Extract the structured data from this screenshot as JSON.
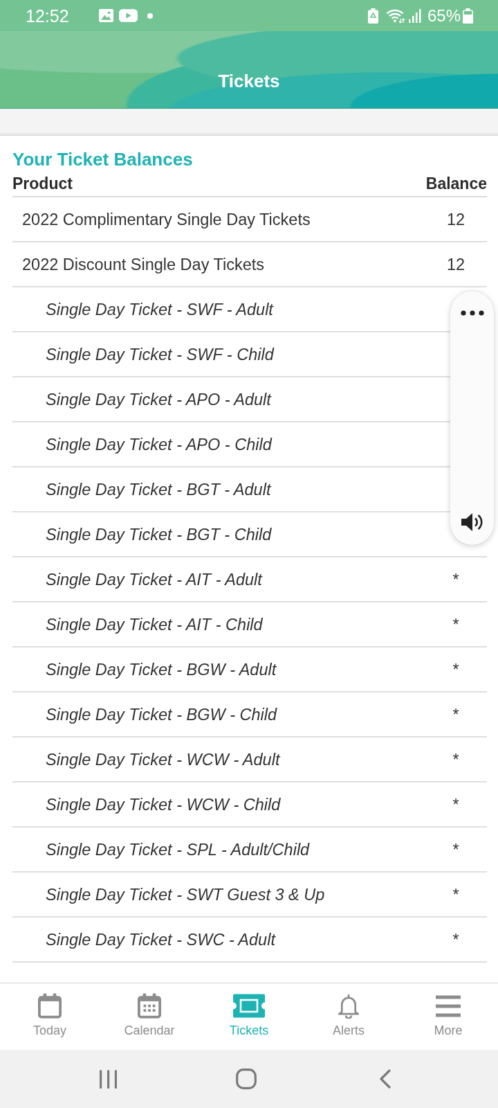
{
  "status_bar": {
    "time": "12:52",
    "battery": "65%"
  },
  "header": {
    "title": "Tickets"
  },
  "balances": {
    "title": "Your Ticket Balances",
    "columns": [
      "Product",
      "Balance"
    ],
    "rows": [
      {
        "product": "2022 Complimentary Single Day Tickets",
        "balance": "12"
      },
      {
        "product": "2022 Discount Single Day Tickets",
        "balance": "12",
        "children": [
          {
            "product": "Single Day Ticket - SWF - Adult"
          },
          {
            "product": "Single Day Ticket - SWF - Child"
          },
          {
            "product": "Single Day Ticket - APO - Adult"
          },
          {
            "product": "Single Day Ticket - APO - Child"
          },
          {
            "product": "Single Day Ticket - BGT - Adult"
          },
          {
            "product": "Single Day Ticket - BGT - Child"
          },
          {
            "product": "Single Day Ticket - AIT - Adult",
            "balance": "*"
          },
          {
            "product": "Single Day Ticket - AIT - Child",
            "balance": "*"
          },
          {
            "product": "Single Day Ticket - BGW - Adult",
            "balance": "*"
          },
          {
            "product": "Single Day Ticket - BGW - Child",
            "balance": "*"
          },
          {
            "product": "Single Day Ticket - WCW - Adult",
            "balance": "*"
          },
          {
            "product": "Single Day Ticket - WCW - Child",
            "balance": "*"
          },
          {
            "product": "Single Day Ticket - SPL - Adult/Child",
            "balance": "*"
          },
          {
            "product": "Single Day Ticket - SWT Guest 3 & Up",
            "balance": "*"
          },
          {
            "product": "Single Day Ticket - SWC - Adult",
            "balance": "*"
          }
        ]
      }
    ]
  },
  "tab_bar": {
    "items": [
      {
        "label": "Today",
        "selected": false
      },
      {
        "label": "Calendar",
        "selected": false
      },
      {
        "label": "Tickets",
        "selected": true
      },
      {
        "label": "Alerts",
        "selected": false
      },
      {
        "label": "More",
        "selected": false
      }
    ]
  }
}
